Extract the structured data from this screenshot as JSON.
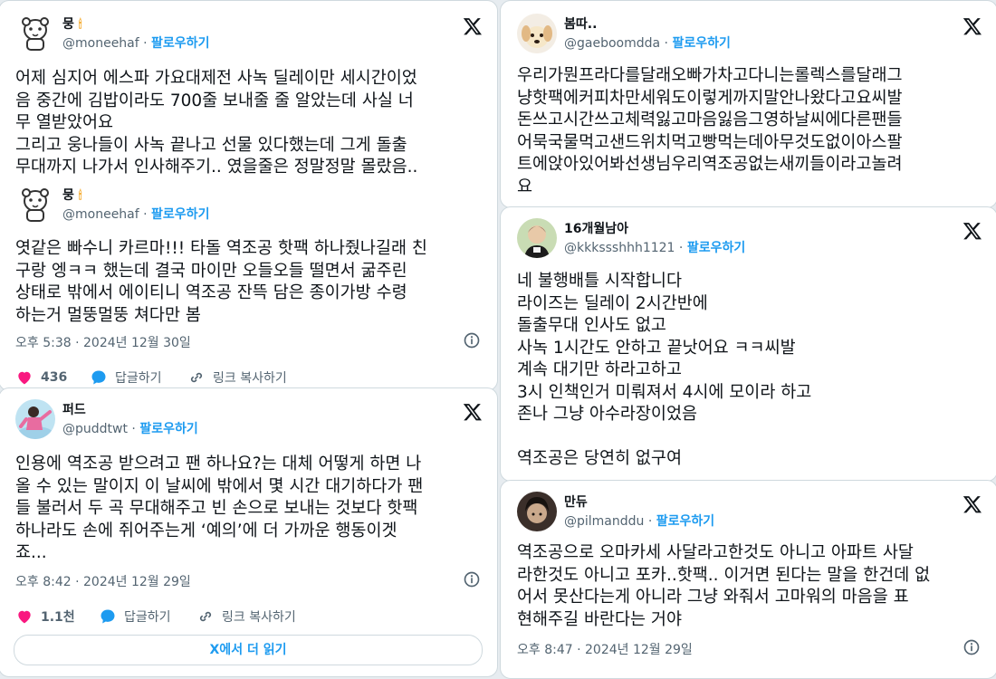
{
  "cards": {
    "c1": {
      "t1": {
        "name": "뭉",
        "handle": "@moneehaf",
        "follow": "팔로우하기",
        "text": "어제 심지어 에스파 가요대제전 사녹 딜레이만 세시간이었\n음 중간에 김밥이라도 700줄 보내줄 줄 알았는데 사실 너\n무 열받았어요\n그리고 웅나들이 사녹 끝나고 선물 있다했는데 그게 돌출\n무대까지 나가서 인사해주기.. 였을줄은 정말정말 몰랐음.."
      },
      "t2": {
        "name": "뭉",
        "handle": "@moneehaf",
        "follow": "팔로우하기",
        "text": "엿같은 빠수니 카르마!!! 타돌 역조공 핫팩 하나줬나길래 친\n구랑 엥ㅋㅋ 했는데 결국 마이만 오들오들 떨면서 굶주린\n상태로 밖에서 에이티니 역조공 잔뜩 담은 종이가방 수령\n하는거 멀뚱멀뚱 쳐다만 봄",
        "time": "오후 5:38 · 2024년 12월 30일",
        "likes": "436",
        "reply": "답글하기",
        "copy": "링크 복사하기"
      }
    },
    "c2": {
      "name": "퍼드",
      "handle": "@puddtwt",
      "follow": "팔로우하기",
      "text": "인용에 역조공 받으려고 팬 하나요?는 대체 어떻게 하면 나\n올 수 있는 말이지 이 날씨에 밖에서 몇 시간 대기하다가 팬\n들 불러서 두 곡 무대해주고 빈 손으로 보내는 것보다 핫팩\n하나라도 손에 쥐어주는게 ‘예의’에 더 가까운 행동이겟\n죠...",
      "time": "오후 8:42 · 2024년 12월 29일",
      "likes": "1.1천",
      "reply": "답글하기",
      "copy": "링크 복사하기",
      "readmore": "X에서 더 읽기"
    },
    "c3": {
      "name": "봄따..",
      "handle": "@gaeboomdda",
      "follow": "팔로우하기",
      "text": "우리가뭔프라다를달래오빠가차고다니는롤렉스를달래그\n냥핫팩에커피차만세워도이렇게까지말안나왔다고요씨발\n돈쓰고시간쓰고체력잃고마음잃음그영하날씨에다른팬들\n어묵국물먹고샌드위치먹고빵먹는데아무것도없이아스팔\n트에앉아있어봐선생님우리역조공없는새끼들이라고놀려\n요"
    },
    "c4": {
      "name": "16개월남아",
      "handle": "@kkkssshhh1121",
      "follow": "팔로우하기",
      "text": "네 불행배틀 시작합니다\n라이즈는 딜레이 2시간반에\n돌출무대 인사도 없고\n사녹 1시간도 안하고 끝낫어요 ㅋㅋ씨발\n계속 대기만 하라고하고\n3시 인책인거 미뤄져서 4시에 모이라 하고\n존나 그냥 아수라장이었음\n\n역조공은 당연히 없구여"
    },
    "c5": {
      "name": "만듀",
      "handle": "@pilmanddu",
      "follow": "팔로우하기",
      "text": "역조공으로 오마카세 사달라고한것도 아니고 아파트 사달\n라한것도 아니고 포카..핫팩.. 이거면 된다는 말을 한건데 없\n어서 못산다는게 아니라 그냥 와줘서 고마워의 마음을 표\n현해주길 바란다는 거야",
      "time": "오후 8:47 · 2024년 12월 29일"
    }
  },
  "icons": {
    "x": "x-logo-icon",
    "info": "info-icon",
    "heart": "heart-icon",
    "reply": "reply-bubble-icon",
    "link": "link-icon",
    "candle": "candle-emoji-icon"
  },
  "colors": {
    "accent": "#1d9bf0",
    "heart": "#f91880",
    "text": "#0f1419",
    "muted": "#536471",
    "border": "#cfd9de"
  }
}
